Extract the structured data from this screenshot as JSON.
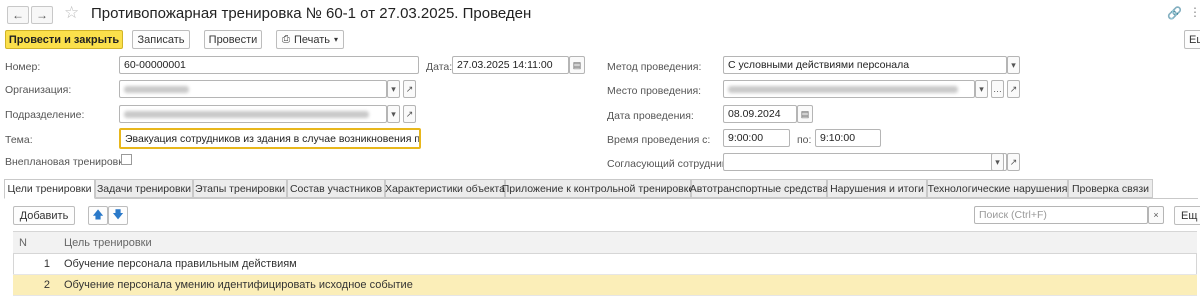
{
  "header": {
    "back_icon": "arrow-left-icon",
    "forward_icon": "arrow-right-icon",
    "favorite_icon": "star-icon",
    "title": "Противопожарная тренировка № 60-1 от 27.03.2025. Проведен",
    "link_icon": "link-icon",
    "more_icon": "more-vertical-icon"
  },
  "toolbar": {
    "post_close": "Провести и закрыть",
    "save": "Записать",
    "post": "Провести",
    "print": "Печать",
    "more": "Ещ"
  },
  "form": {
    "number_label": "Номер:",
    "number_value": "60-00000001",
    "date_label": "Дата:",
    "date_value": "27.03.2025 14:11:00",
    "org_label": "Организация:",
    "dept_label": "Подразделение:",
    "topic_label": "Тема:",
    "topic_value": "Эвакуация сотрудников из здания в случае возникновения пожара",
    "unplanned_label": "Внеплановая тренировка:",
    "method_label": "Метод проведения:",
    "method_value": "С условными действиями персонала",
    "place_label": "Место проведения:",
    "date2_label": "Дата проведения:",
    "date2_value": "08.09.2024",
    "time_label": "Время проведения с:",
    "time_from": "9:00:00",
    "time_to_label": "по:",
    "time_to": "9:10:00",
    "approver_label": "Согласующий сотрудник:"
  },
  "tabs": [
    "Цели тренировки",
    "Задачи тренировки",
    "Этапы тренировки",
    "Состав участников",
    "Характеристики объекта",
    "Приложение к контрольной тренировке",
    "Автотранспортные средства",
    "Нарушения и итоги",
    "Технологические нарушения",
    "Проверка связи"
  ],
  "table_toolbar": {
    "add": "Добавить",
    "search_placeholder": "Поиск (Ctrl+F)",
    "more": "Ещ"
  },
  "table": {
    "col_n": "N",
    "col_goal": "Цель тренировки",
    "rows": [
      {
        "n": "1",
        "goal": "Обучение персонала правильным действиям"
      },
      {
        "n": "2",
        "goal": "Обучение персонала умению идентифицировать исходное событие"
      }
    ]
  },
  "colors": {
    "primary_button": "#fbe04b",
    "selected_row": "#fbeeb8",
    "topic_focus": "#e8b71c"
  }
}
